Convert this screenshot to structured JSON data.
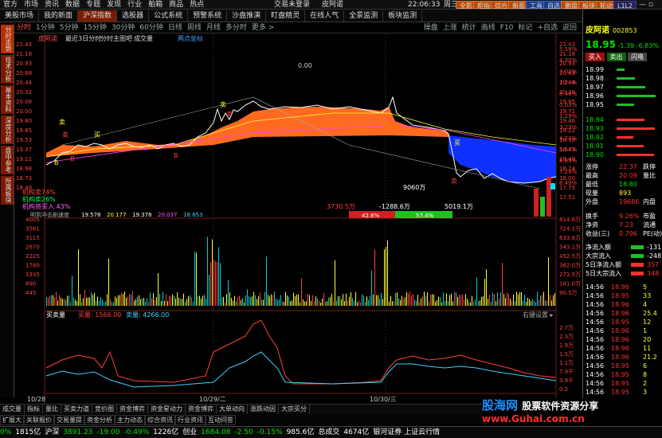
{
  "menu": {
    "items": [
      "官方",
      "市场",
      "资讯",
      "数据",
      "专题",
      "发现",
      "行业",
      "舶箱",
      "商品",
      "热点"
    ],
    "title": "交易未登录",
    "stock_name": "皮阿诺",
    "clock": "22:06:33",
    "weekday": "周三",
    "tools": [
      "全影",
      "柜指",
      "综合",
      "新面",
      "工具",
      "自选",
      "删盘",
      "板块",
      "轮动",
      "L1L2"
    ]
  },
  "nav1": [
    "美股市场",
    "我的新面",
    "沪深指数",
    "选股器",
    "公式系统",
    "预警系统",
    "沙盘推演",
    "盯盘精灵",
    "在线人气",
    "全景监测",
    "板块监测"
  ],
  "nav2": [
    "分时",
    "1分钟",
    "5分钟",
    "15分钟",
    "30分钟",
    "60分钟",
    "日线",
    "周线",
    "月线",
    "多分时",
    "更多 >"
  ],
  "nav2r": [
    "操盘",
    "上涨",
    "统计",
    "画线",
    "F10",
    "标记",
    "+自选",
    "返回"
  ],
  "sidetabs": [
    "分时走势",
    "技术分析",
    "基本资料",
    "深度分析",
    "盘中参考",
    "所属板块"
  ],
  "chart": {
    "header": {
      "name": "皮阿诺",
      "mode": "最近3日分时",
      "main": "分时主图吧",
      "indicator": "成交量",
      "coord": "两点坐标"
    },
    "price_ticks": [
      "21.43",
      "21.18",
      "20.93",
      "20.68",
      "20.44",
      "20.20",
      "19.95",
      "19.71",
      "19.46",
      "19.22",
      "18.98",
      "18.73",
      "18.49",
      "18.24",
      "18.00",
      "17.75",
      "17.51"
    ],
    "price_ticks_l": [
      "21.43",
      "21.18",
      "20.93",
      "20.68",
      "20.44",
      "20.32",
      "20.08",
      "20.00",
      "19.80",
      "19.65",
      "19.53",
      "19.37",
      "19.12",
      "18.98",
      "18.73",
      "18.49"
    ],
    "pct_ticks": [
      "5.58%",
      "4.30%",
      "3.02%",
      "1.74%",
      "0.46%",
      "0.03%",
      "1.29%",
      "3.23%",
      "4.23%",
      "5.64%",
      "6.89%",
      "7.24%",
      "8.49%"
    ],
    "vol_ticks": [
      "4005",
      "3561",
      "3115",
      "2670",
      "2225",
      "1780",
      "1335",
      "890",
      "445"
    ],
    "vol_ticks_r": [
      "814.6万",
      "724.1万",
      "633.6万",
      "543.1万",
      "452.5万",
      "362.0万",
      "271.5万",
      "181.0万",
      "90.5万"
    ],
    "zero_label": "0.00",
    "mid_labels": [
      "3730.5万",
      "-1288.6万",
      "5019.1万",
      "9060万"
    ],
    "bar_pct": [
      "42.6%",
      "57.4%"
    ],
    "annot": [
      "卖",
      "卖",
      "B",
      "B",
      "卖",
      "卖",
      "买",
      "卖",
      "买",
      "B"
    ],
    "legend": [
      "机构卖74%",
      "机构卖26%",
      "机构资买入 43%"
    ],
    "ma_label": "明到冲击剧速度",
    "ma_values": [
      "19.578",
      "20.177",
      "19.378",
      "20.037",
      "18.853"
    ],
    "lower_title": "买卖量",
    "buy": "买量: 1566.00",
    "sell": "卖量: 4266.00",
    "lower_right": "右键设置 ▸",
    "lower_ticks": [
      "2.7万",
      "2.3万",
      "1.9万",
      "1.5万",
      "1.1万",
      "7.9千",
      "3.9千",
      "0.2"
    ],
    "dates": [
      "10/28",
      "10/29/二",
      "10/30/三"
    ]
  },
  "right": {
    "name": "皮阿诺",
    "code": "002853",
    "price": "18.95",
    "change": "-1.39",
    "pct": "-6.83%",
    "buttons": [
      "买入",
      "卖出",
      "闪电"
    ],
    "book": [
      [
        "18.99",
        "wht"
      ],
      [
        "18.98",
        "wht"
      ],
      [
        "18.97",
        "wht"
      ],
      [
        "18.96",
        "wht"
      ],
      [
        "18.95",
        "wht"
      ],
      [
        "18.94",
        "grn"
      ],
      [
        "18.93",
        "grn"
      ],
      [
        "18.92",
        "grn"
      ],
      [
        "18.91",
        "grn"
      ],
      [
        "18.90",
        "grn"
      ]
    ],
    "stats": [
      [
        "涨停",
        "22.37",
        "跌停",
        "red"
      ],
      [
        "最高",
        "20.09",
        "量比",
        "red"
      ],
      [
        "最低",
        "18.80",
        "",
        "grn"
      ],
      [
        "现量",
        "893",
        "",
        "yel"
      ],
      [
        "外盘",
        "19686",
        "内盘",
        "red"
      ]
    ],
    "stats2": [
      [
        "换手",
        "9.26%",
        "市盈"
      ],
      [
        "净资",
        "7.23",
        "流通"
      ],
      [
        "收益(三)",
        "0.796",
        "PE(动)"
      ]
    ],
    "flow": [
      [
        "净流入额",
        "-131"
      ],
      [
        "大宗流入",
        "-248"
      ],
      [
        "5日净流入额",
        "357"
      ],
      [
        "5日大宗流入",
        "348"
      ]
    ],
    "ticks": [
      [
        "14:56",
        "18.96",
        "5"
      ],
      [
        "14:56",
        "18.95",
        "33"
      ],
      [
        "14:56",
        "18.96",
        "4"
      ],
      [
        "14:56",
        "18.96",
        "25.4"
      ],
      [
        "14:56",
        "18.95",
        "12"
      ],
      [
        "14:56",
        "18.96",
        "1"
      ],
      [
        "14:56",
        "18.96",
        "20"
      ],
      [
        "14:56",
        "18.96",
        "11"
      ],
      [
        "14:56",
        "18.96",
        "21.2"
      ],
      [
        "14:56",
        "18.95",
        "6"
      ],
      [
        "14:56",
        "18.95",
        "8"
      ],
      [
        "14:56",
        "18.95",
        "2"
      ],
      [
        "14:56",
        "18.95",
        "3"
      ]
    ]
  },
  "bottom": {
    "tabs1": [
      "成交量",
      "指标",
      "量比",
      "买卖力道",
      "竞价图",
      "资金博弈",
      "资金星动力",
      "资金博弈",
      "大单动向",
      "涨跌动因",
      "大宗买分"
    ],
    "tabs2": [
      "扩展大",
      "关联报价",
      "交易量提",
      "资金分析",
      "主力动态",
      "综合资讯",
      "行业资讯",
      "互动问答"
    ]
  },
  "status": {
    "items": [
      "0%",
      "1815亿",
      "沪深",
      "3891.23",
      "-19.00",
      "-0.49%",
      "1226亿",
      "创业",
      "1684.08",
      "-2.50",
      "-0.15%",
      "985.6亿",
      "总成交",
      "4674亿",
      "银河证券 上证云行情"
    ]
  },
  "watermark": {
    "brand": "股海网",
    "slogan": "股票软件资源分享",
    "url": "www.Guhai.com.cn"
  }
}
